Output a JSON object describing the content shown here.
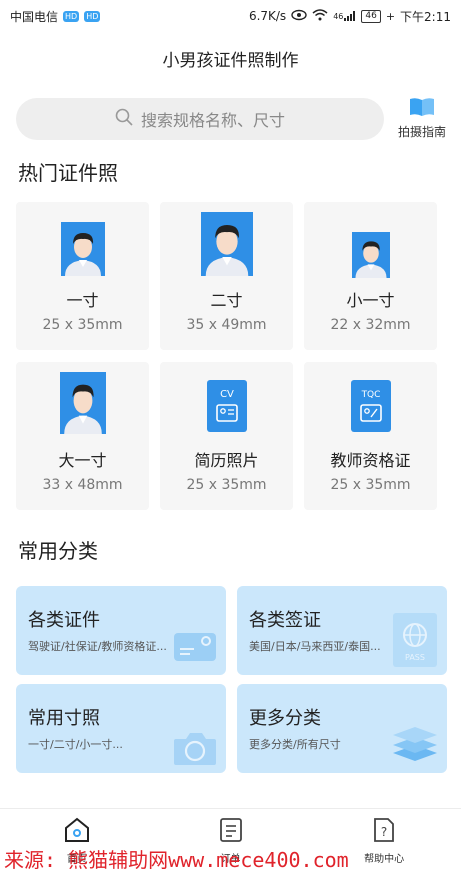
{
  "status_bar": {
    "carrier": "中国电信",
    "hd1": "HD",
    "hd2": "HD",
    "net_speed": "6.7K/s",
    "signal": "46",
    "battery": "46",
    "time": "下午2:11"
  },
  "header": {
    "title": "小男孩证件照制作"
  },
  "search": {
    "placeholder": "搜索规格名称、尺寸"
  },
  "guide": {
    "label": "拍摄指南"
  },
  "hot": {
    "title": "热门证件照",
    "items": [
      {
        "name": "一寸",
        "size": "25 x 35mm"
      },
      {
        "name": "二寸",
        "size": "35 x 49mm"
      },
      {
        "name": "小一寸",
        "size": "22 x 32mm"
      },
      {
        "name": "大一寸",
        "size": "33 x 48mm"
      },
      {
        "name": "简历照片",
        "size": "25 x 35mm",
        "badge": "CV"
      },
      {
        "name": "教师资格证",
        "size": "25 x 35mm",
        "badge": "TQC"
      }
    ]
  },
  "categories": {
    "title": "常用分类",
    "items": [
      {
        "title": "各类证件",
        "subtitle": "驾驶证/社保证/教师资格证..."
      },
      {
        "title": "各类签证",
        "subtitle": "美国/日本/马来西亚/泰国...",
        "badge": "PASS"
      },
      {
        "title": "常用寸照",
        "subtitle": "一寸/二寸/小一寸..."
      },
      {
        "title": "更多分类",
        "subtitle": "更多分类/所有尺寸"
      }
    ]
  },
  "tabbar": {
    "tabs": [
      {
        "label": "首页"
      },
      {
        "label": "订单"
      },
      {
        "label": "帮助中心"
      }
    ]
  },
  "watermark": "来源: 熊猫辅助网www.mece400.com",
  "colors": {
    "accent": "#3aa3f2",
    "card_bg": "#f6f6f6",
    "category_bg": "#cbe7fb"
  }
}
